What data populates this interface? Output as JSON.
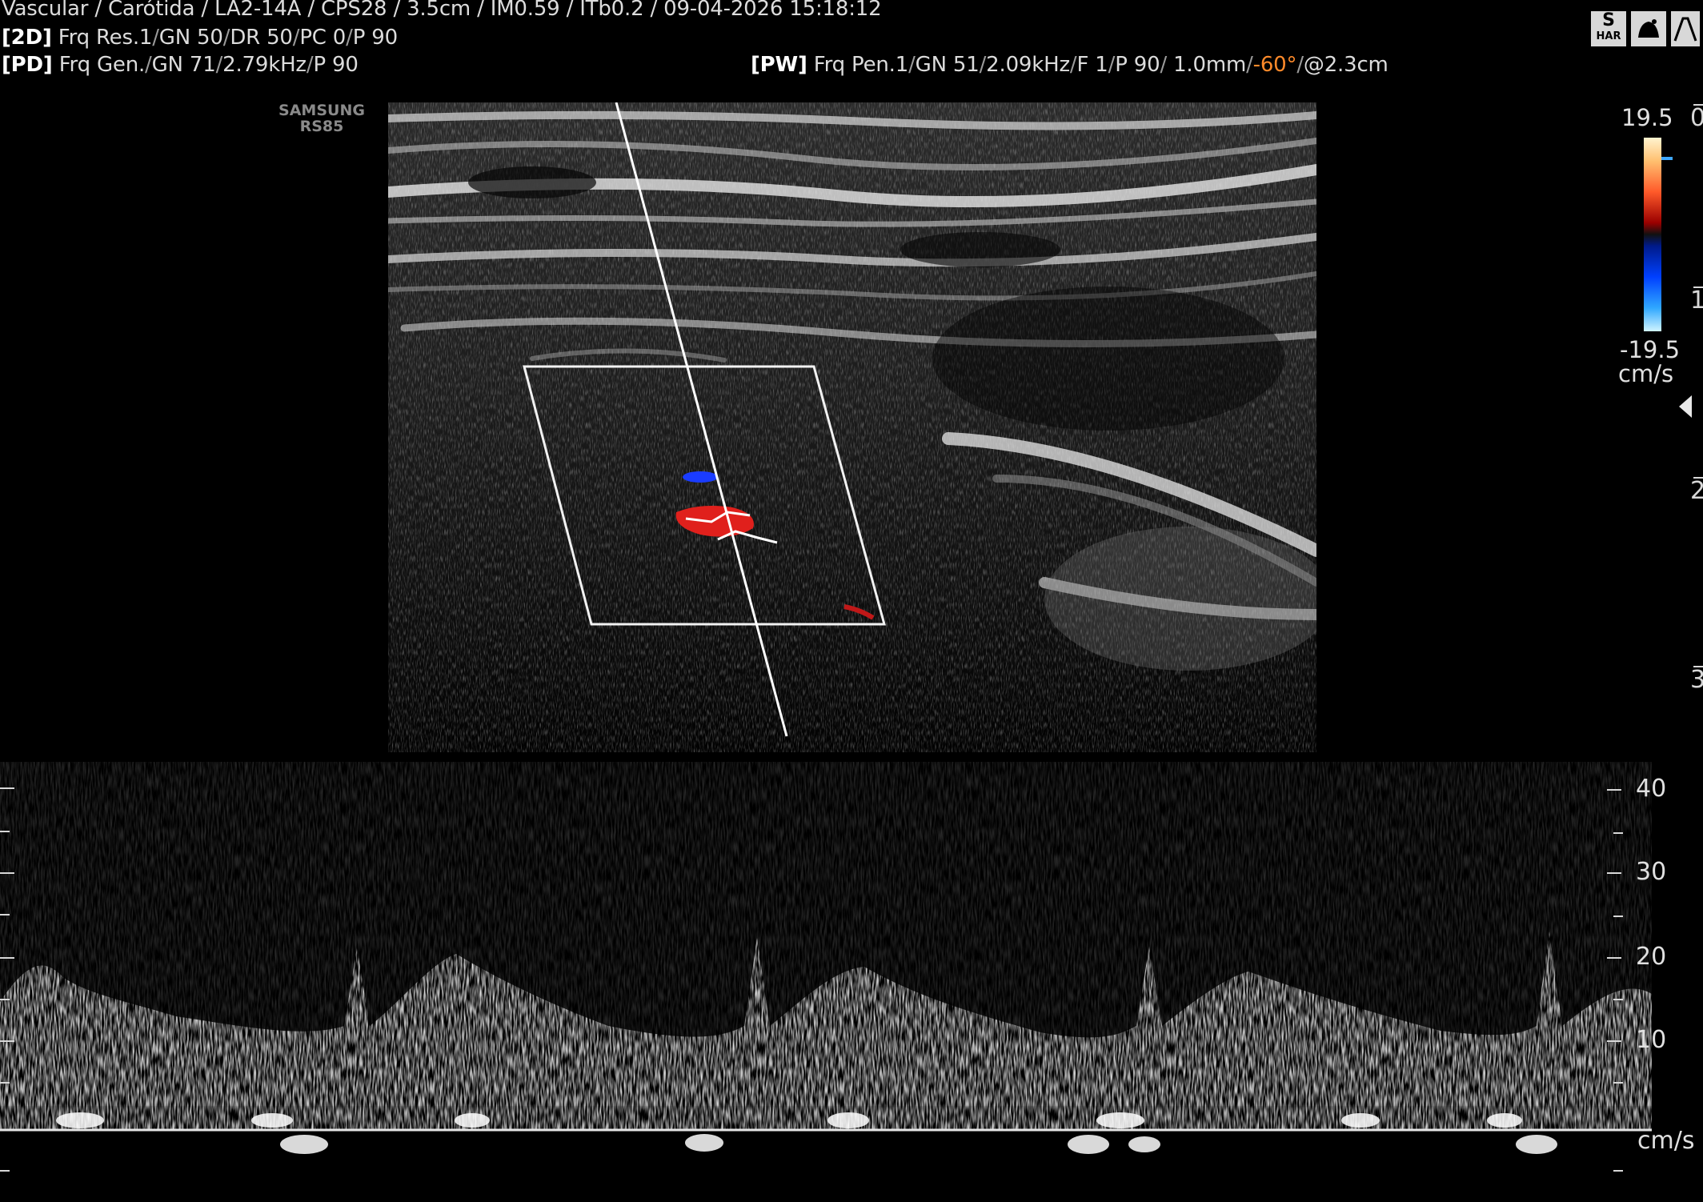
{
  "header": {
    "line1": "Vascular / Carótida / LA2-14A / CPS28 / 3.5cm / IM0.59 / ITb0.2 / 09-04-2026 15:18:12",
    "line2": {
      "tag": "[2D]",
      "params": [
        "Frq Res.1",
        "GN 50",
        "DR 50",
        "PC 0",
        "P 90"
      ]
    },
    "line3": {
      "tag": "[PD]",
      "params": [
        "Frq Gen.",
        "GN 71",
        "2.79kHz",
        "P 90"
      ]
    },
    "pw": {
      "tag": "[PW]",
      "params": [
        "Frq Pen.1",
        "GN 51",
        "2.09kHz",
        "F 1",
        "P 90",
        " 1.0mm"
      ],
      "angle": "-60°",
      "gate": "@2.3cm"
    }
  },
  "brand": {
    "line1": "SAMSUNG",
    "line2": "RS85"
  },
  "icons": [
    {
      "name": "har-icon",
      "label": "S"
    },
    {
      "name": "probe-icon",
      "label": ""
    },
    {
      "name": "trace-icon",
      "label": ""
    }
  ],
  "icon_sub": "HAR",
  "color_bar": {
    "top": "19.5",
    "bottom": "-19.5",
    "unit": "cm/s"
  },
  "depth_scale": [
    "0",
    "1",
    "2",
    "3"
  ],
  "doppler_scale": {
    "labels": [
      "40",
      "30",
      "20",
      "10"
    ],
    "unit": "cm/s"
  },
  "colors": {
    "accent_angle": "#ff8a2a",
    "flow_red": "#e0201c",
    "flow_blue": "#1a3cff"
  }
}
